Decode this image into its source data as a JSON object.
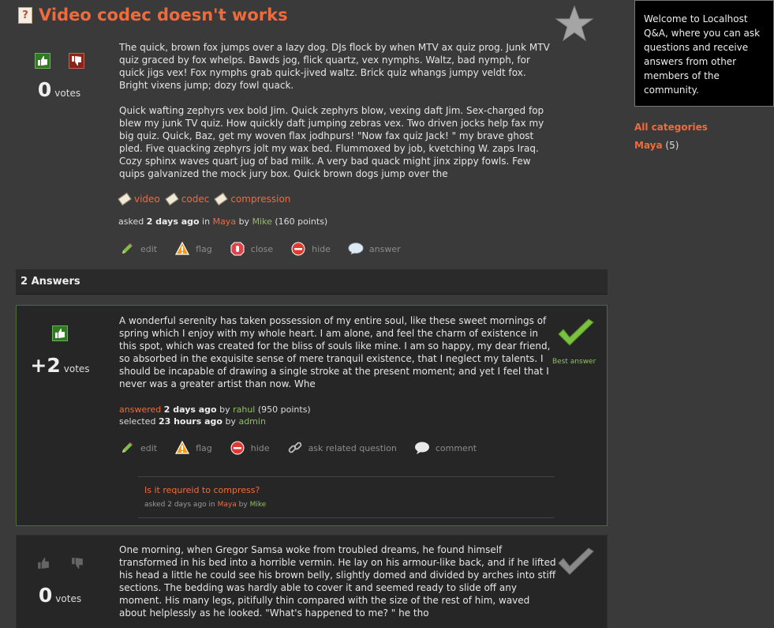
{
  "question": {
    "title": "Video codec doesn't works",
    "votes": "0",
    "votes_label": "votes",
    "body": [
      "The quick, brown fox jumps over a lazy dog. DJs flock by when MTV ax quiz prog. Junk MTV quiz graced by fox whelps. Bawds jog, flick quartz, vex nymphs. Waltz, bad nymph, for quick jigs vex! Fox nymphs grab quick-jived waltz. Brick quiz whangs jumpy veldt fox. Bright vixens jump; dozy fowl quack.",
      "Quick wafting zephyrs vex bold Jim. Quick zephyrs blow, vexing daft Jim. Sex-charged fop blew my junk TV quiz. How quickly daft jumping zebras vex. Two driven jocks help fax my big quiz. Quick, Baz, get my woven flax jodhpurs! \"Now fax quiz Jack! \" my brave ghost pled. Five quacking zephyrs jolt my wax bed. Flummoxed by job, kvetching W. zaps Iraq. Cozy sphinx waves quart jug of bad milk. A very bad quack might jinx zippy fowls. Few quips galvanized the mock jury box. Quick brown dogs jump over the"
    ],
    "tags": [
      "video",
      "codec",
      "compression"
    ],
    "meta": {
      "asked": "asked",
      "when": "2 days ago",
      "in": "in",
      "category": "Maya",
      "by": "by",
      "user": "Mike",
      "points": "(160 points)"
    },
    "actions": {
      "edit": "edit",
      "flag": "flag",
      "close": "close",
      "hide": "hide",
      "answer": "answer"
    }
  },
  "answers_header": "2 Answers",
  "answers": [
    {
      "votes": "+2",
      "votes_label": "votes",
      "body": "A wonderful serenity has taken possession of my entire soul, like these sweet mornings of spring which I enjoy with my whole heart. I am alone, and feel the charm of existence in this spot, which was created for the bliss of souls like mine. I am so happy, my dear friend, so absorbed in the exquisite sense of mere tranquil existence, that I neglect my talents. I should be incapable of drawing a single stroke at the present moment; and yet I feel that I never was a greater artist than now. Whe",
      "best_label": "Best answer",
      "meta": {
        "answered": "answered",
        "when": "2 days ago",
        "by": "by",
        "user": "rahul",
        "points": "(950 points)",
        "selected": "selected",
        "selected_when": "23 hours ago",
        "selected_by": "by",
        "selected_user": "admin"
      },
      "actions": {
        "edit": "edit",
        "flag": "flag",
        "hide": "hide",
        "ask_related": "ask related question",
        "comment": "comment"
      },
      "comment": {
        "text": "Is it requreid to compress?",
        "asked": "asked",
        "when": "2 days ago",
        "in": "in",
        "category": "Maya",
        "by": "by",
        "user": "Mike"
      }
    },
    {
      "votes": "0",
      "votes_label": "votes",
      "body": "One morning, when Gregor Samsa woke from troubled dreams, he found himself transformed in his bed into a horrible vermin. He lay on his armour-like back, and if he lifted his head a little he could see his brown belly, slightly domed and divided by arches into stiff sections. The bedding was hardly able to cover it and seemed ready to slide off any moment. His many legs, pitifully thin compared with the size of the rest of him, waved about helplessly as he looked. \"What's happened to me? \" he tho"
    }
  ],
  "sidebar": {
    "welcome": "Welcome to Localhost Q&A, where you can ask questions and receive answers from other members of the community.",
    "all_categories": "All categories",
    "categories": [
      {
        "name": "Maya",
        "count": "(5)"
      }
    ]
  },
  "colors": {
    "accent": "#f06b3c",
    "user_green": "#8ec05e",
    "background": "#3a3a3a",
    "panel": "#262626"
  }
}
